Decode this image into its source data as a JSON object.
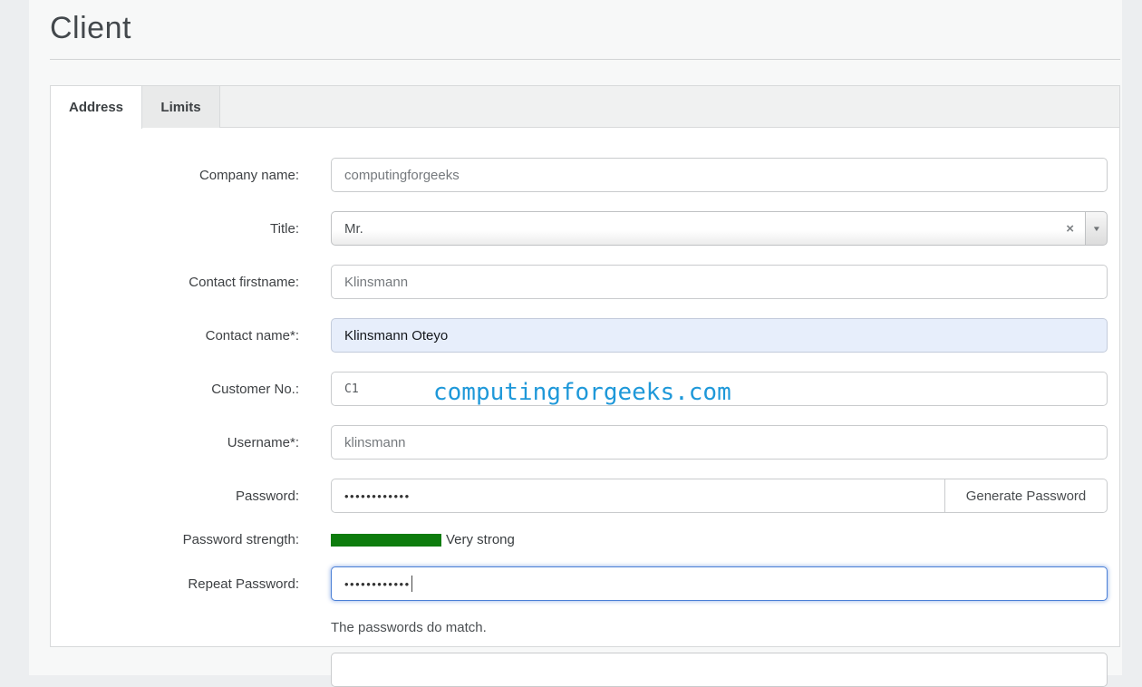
{
  "page": {
    "title": "Client"
  },
  "tabs": [
    {
      "label": "Address",
      "active": true
    },
    {
      "label": "Limits",
      "active": false
    }
  ],
  "form": {
    "company_name": {
      "label": "Company name:",
      "value": "computingforgeeks"
    },
    "title": {
      "label": "Title:",
      "value": "Mr."
    },
    "contact_firstname": {
      "label": "Contact firstname:",
      "value": "Klinsmann"
    },
    "contact_name": {
      "label": "Contact name*:",
      "value": "Klinsmann Oteyo"
    },
    "customer_no": {
      "label": "Customer No.:",
      "value": "C1"
    },
    "username": {
      "label": "Username*:",
      "value": "klinsmann"
    },
    "password": {
      "label": "Password:",
      "value": "••••••••••••",
      "button_label": "Generate Password"
    },
    "password_strength": {
      "label": "Password strength:",
      "status": "Very strong",
      "bar_color": "#0d7c0d"
    },
    "repeat_password": {
      "label": "Repeat Password:",
      "value": "••••••••••••"
    },
    "messages": {
      "passwords_match": "The passwords do match."
    }
  },
  "icons": {
    "clear": "×",
    "dropdown": "▼"
  },
  "watermark": {
    "text": "computingforgeeks.com",
    "color": "#1e98d9"
  },
  "colors": {
    "accent_focus_border": "#4a7fd6",
    "autofill_background": "#e7eefb",
    "strength_green": "#0d7c0d",
    "watermark_blue": "#1e98d9"
  }
}
